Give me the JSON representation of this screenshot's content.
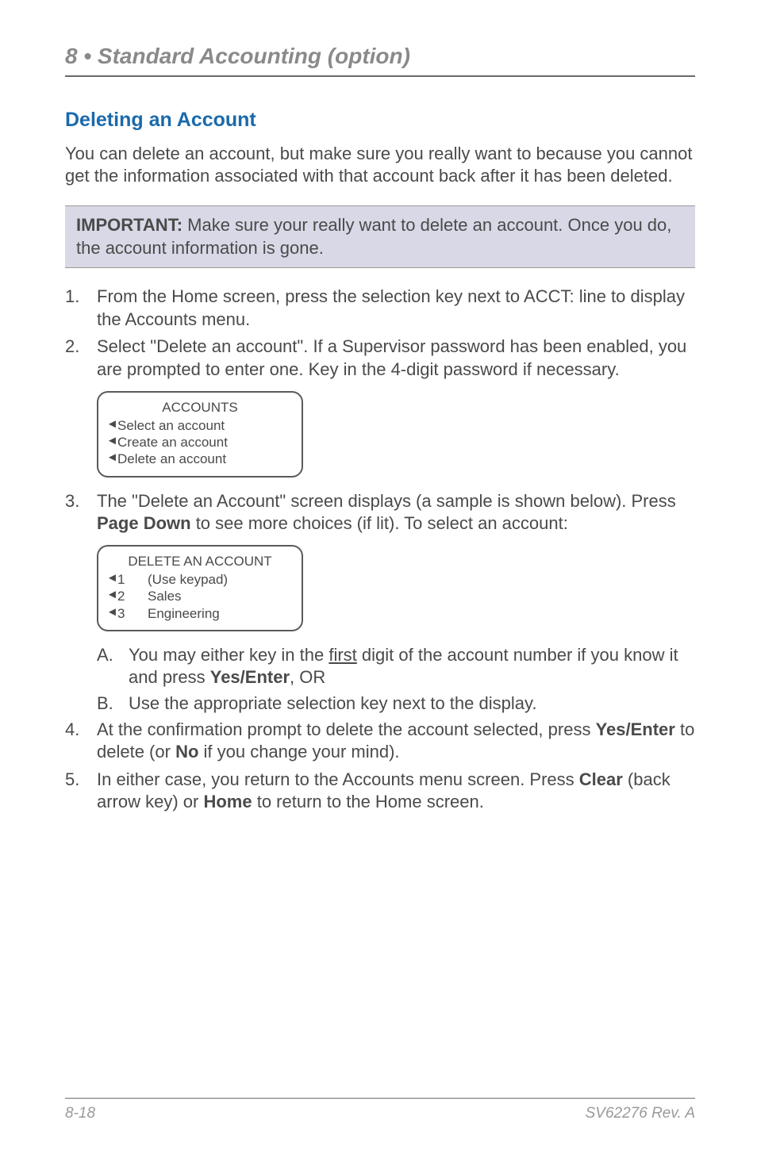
{
  "chapter": "8 • Standard Accounting (option)",
  "section_title": "Deleting an Account",
  "intro": "You can delete an account, but make sure you really want to because you cannot get the information associated with that account back after it has been deleted.",
  "important": {
    "label": "IMPORTANT:",
    "text": " Make sure your really want to delete an account. Once you do, the account information is gone."
  },
  "step1": {
    "num": "1.",
    "text": "From the Home screen, press the selection key next to ACCT: line to display the Accounts menu."
  },
  "step2": {
    "num": "2.",
    "text": "Select \"Delete an account\". If a Supervisor password has been enabled, you are prompted to enter one. Key in the 4-digit password if necessary."
  },
  "screen1": {
    "title": "ACCOUNTS",
    "rows": [
      "Select an account",
      "Create an account",
      "Delete an account"
    ]
  },
  "step3": {
    "num": "3.",
    "pre": "The \"Delete an Account\" screen displays (a sample is shown below). Press ",
    "bold1": "Page Down",
    "post": " to see more choices (if lit). To select an account:"
  },
  "screen2": {
    "title": "DELETE AN ACCOUNT",
    "rows": [
      {
        "n": "1",
        "t": "(Use keypad)"
      },
      {
        "n": "2",
        "t": "Sales"
      },
      {
        "n": "3",
        "t": "Engineering"
      }
    ]
  },
  "subA": {
    "letter": "A.",
    "pre": "You may either key in the ",
    "under": "first",
    "mid": " digit of the account number if you know it and press ",
    "bold": "Yes/Enter",
    "post": ",  OR"
  },
  "subB": {
    "letter": "B.",
    "text": "Use the appropriate selection key next to the display."
  },
  "step4": {
    "num": "4.",
    "pre": "At the confirmation prompt to delete the account selected, press ",
    "bold1": "Yes/Enter",
    "mid": " to delete (or ",
    "bold2": "No",
    "post": " if you change your mind)."
  },
  "step5": {
    "num": "5.",
    "pre": "In either case, you return to the Accounts menu screen. Press ",
    "bold1": "Clear",
    "mid": " (back arrow key) or ",
    "bold2": "Home",
    "post": " to return to the Home screen."
  },
  "footer": {
    "left": "8-18",
    "right": "SV62276 Rev. A"
  },
  "arrow": "◄"
}
